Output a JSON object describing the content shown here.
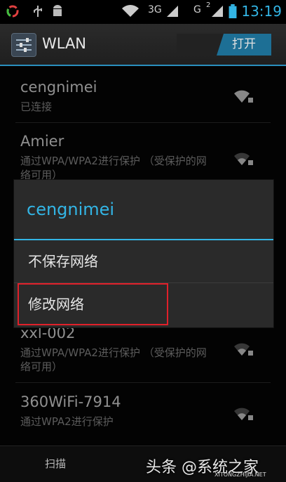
{
  "status_bar": {
    "network_3g": "3G",
    "network_g": "G",
    "sim2": "2",
    "time": "13:19"
  },
  "action_bar": {
    "title": "WLAN",
    "toggle_on_label": "打开"
  },
  "networks": [
    {
      "name": "cengnimei",
      "status": "已连接"
    },
    {
      "name": "Amier",
      "status": "通过WPA/WPA2进行保护 （受保护的网络可用）"
    },
    {
      "name": "xxl-002",
      "status": "通过WPA/WPA2进行保护 （受保护的网络可用）"
    },
    {
      "name": "360WiFi-7914",
      "status": "通过WPA2进行保护"
    }
  ],
  "dialog": {
    "title": "cengnimei",
    "options": [
      {
        "label": "不保存网络"
      },
      {
        "label": "修改网络"
      }
    ]
  },
  "bottom_bar": {
    "scan_label": "扫描",
    "watermark": "头条 @系统之家",
    "watermark_sub": "XITONGZHIJIA.NET"
  },
  "colors": {
    "accent": "#33b5e5",
    "highlight_border": "#e0202a"
  }
}
